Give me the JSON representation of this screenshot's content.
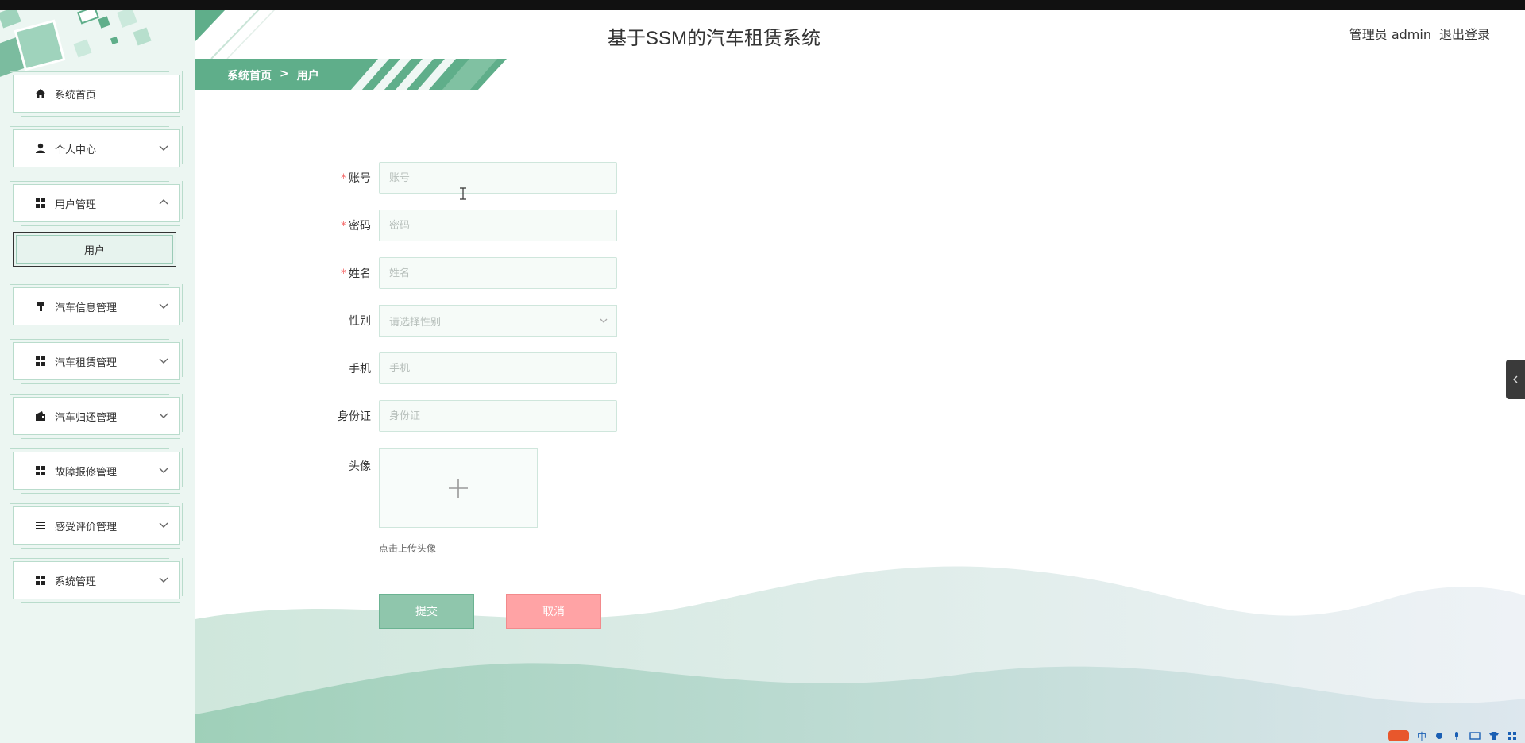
{
  "header": {
    "title": "基于SSM的汽车租赁系统",
    "user": "管理员 admin",
    "logout": "退出登录"
  },
  "breadcrumb": {
    "home": "系统首页",
    "separator": ">",
    "current": "用户"
  },
  "sidebar": {
    "items": [
      {
        "label": "系统首页",
        "icon": "home-icon"
      },
      {
        "label": "个人中心",
        "icon": "user-icon"
      },
      {
        "label": "用户管理",
        "icon": "grid-icon"
      },
      {
        "label": "汽车信息管理",
        "icon": "brush-icon"
      },
      {
        "label": "汽车租赁管理",
        "icon": "grid-icon"
      },
      {
        "label": "汽车归还管理",
        "icon": "wallet-icon"
      },
      {
        "label": "故障报修管理",
        "icon": "grid-icon"
      },
      {
        "label": "感受评价管理",
        "icon": "list-icon"
      },
      {
        "label": "系统管理",
        "icon": "grid-icon"
      }
    ],
    "submenu": {
      "label": "用户"
    }
  },
  "form": {
    "account": {
      "label": "账号",
      "placeholder": "账号",
      "required": true
    },
    "password": {
      "label": "密码",
      "placeholder": "密码",
      "required": true
    },
    "name": {
      "label": "姓名",
      "placeholder": "姓名",
      "required": true
    },
    "gender": {
      "label": "性别",
      "placeholder": "请选择性别"
    },
    "phone": {
      "label": "手机",
      "placeholder": "手机"
    },
    "idcard": {
      "label": "身份证",
      "placeholder": "身份证"
    },
    "avatar": {
      "label": "头像",
      "tip": "点击上传头像"
    },
    "submit": "提交",
    "cancel": "取消"
  },
  "tray": {
    "ime": "中"
  },
  "colors": {
    "accent": "#5fae8a",
    "sidebar_bg": "#ecf6f2",
    "cancel": "#ffa3a5",
    "submit": "#8fc6ac",
    "required": "#f56c6c"
  }
}
